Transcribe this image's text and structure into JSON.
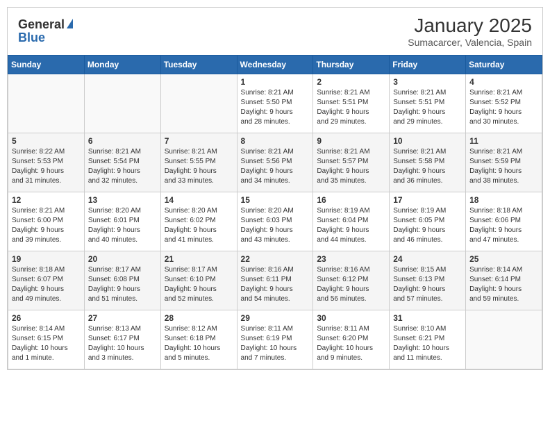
{
  "header": {
    "logo_general": "General",
    "logo_blue": "Blue",
    "month_year": "January 2025",
    "location": "Sumacarcer, Valencia, Spain"
  },
  "weekdays": [
    "Sunday",
    "Monday",
    "Tuesday",
    "Wednesday",
    "Thursday",
    "Friday",
    "Saturday"
  ],
  "weeks": [
    [
      {
        "day": "",
        "content": ""
      },
      {
        "day": "",
        "content": ""
      },
      {
        "day": "",
        "content": ""
      },
      {
        "day": "1",
        "content": "Sunrise: 8:21 AM\nSunset: 5:50 PM\nDaylight: 9 hours\nand 28 minutes."
      },
      {
        "day": "2",
        "content": "Sunrise: 8:21 AM\nSunset: 5:51 PM\nDaylight: 9 hours\nand 29 minutes."
      },
      {
        "day": "3",
        "content": "Sunrise: 8:21 AM\nSunset: 5:51 PM\nDaylight: 9 hours\nand 29 minutes."
      },
      {
        "day": "4",
        "content": "Sunrise: 8:21 AM\nSunset: 5:52 PM\nDaylight: 9 hours\nand 30 minutes."
      }
    ],
    [
      {
        "day": "5",
        "content": "Sunrise: 8:22 AM\nSunset: 5:53 PM\nDaylight: 9 hours\nand 31 minutes."
      },
      {
        "day": "6",
        "content": "Sunrise: 8:21 AM\nSunset: 5:54 PM\nDaylight: 9 hours\nand 32 minutes."
      },
      {
        "day": "7",
        "content": "Sunrise: 8:21 AM\nSunset: 5:55 PM\nDaylight: 9 hours\nand 33 minutes."
      },
      {
        "day": "8",
        "content": "Sunrise: 8:21 AM\nSunset: 5:56 PM\nDaylight: 9 hours\nand 34 minutes."
      },
      {
        "day": "9",
        "content": "Sunrise: 8:21 AM\nSunset: 5:57 PM\nDaylight: 9 hours\nand 35 minutes."
      },
      {
        "day": "10",
        "content": "Sunrise: 8:21 AM\nSunset: 5:58 PM\nDaylight: 9 hours\nand 36 minutes."
      },
      {
        "day": "11",
        "content": "Sunrise: 8:21 AM\nSunset: 5:59 PM\nDaylight: 9 hours\nand 38 minutes."
      }
    ],
    [
      {
        "day": "12",
        "content": "Sunrise: 8:21 AM\nSunset: 6:00 PM\nDaylight: 9 hours\nand 39 minutes."
      },
      {
        "day": "13",
        "content": "Sunrise: 8:20 AM\nSunset: 6:01 PM\nDaylight: 9 hours\nand 40 minutes."
      },
      {
        "day": "14",
        "content": "Sunrise: 8:20 AM\nSunset: 6:02 PM\nDaylight: 9 hours\nand 41 minutes."
      },
      {
        "day": "15",
        "content": "Sunrise: 8:20 AM\nSunset: 6:03 PM\nDaylight: 9 hours\nand 43 minutes."
      },
      {
        "day": "16",
        "content": "Sunrise: 8:19 AM\nSunset: 6:04 PM\nDaylight: 9 hours\nand 44 minutes."
      },
      {
        "day": "17",
        "content": "Sunrise: 8:19 AM\nSunset: 6:05 PM\nDaylight: 9 hours\nand 46 minutes."
      },
      {
        "day": "18",
        "content": "Sunrise: 8:18 AM\nSunset: 6:06 PM\nDaylight: 9 hours\nand 47 minutes."
      }
    ],
    [
      {
        "day": "19",
        "content": "Sunrise: 8:18 AM\nSunset: 6:07 PM\nDaylight: 9 hours\nand 49 minutes."
      },
      {
        "day": "20",
        "content": "Sunrise: 8:17 AM\nSunset: 6:08 PM\nDaylight: 9 hours\nand 51 minutes."
      },
      {
        "day": "21",
        "content": "Sunrise: 8:17 AM\nSunset: 6:10 PM\nDaylight: 9 hours\nand 52 minutes."
      },
      {
        "day": "22",
        "content": "Sunrise: 8:16 AM\nSunset: 6:11 PM\nDaylight: 9 hours\nand 54 minutes."
      },
      {
        "day": "23",
        "content": "Sunrise: 8:16 AM\nSunset: 6:12 PM\nDaylight: 9 hours\nand 56 minutes."
      },
      {
        "day": "24",
        "content": "Sunrise: 8:15 AM\nSunset: 6:13 PM\nDaylight: 9 hours\nand 57 minutes."
      },
      {
        "day": "25",
        "content": "Sunrise: 8:14 AM\nSunset: 6:14 PM\nDaylight: 9 hours\nand 59 minutes."
      }
    ],
    [
      {
        "day": "26",
        "content": "Sunrise: 8:14 AM\nSunset: 6:15 PM\nDaylight: 10 hours\nand 1 minute."
      },
      {
        "day": "27",
        "content": "Sunrise: 8:13 AM\nSunset: 6:17 PM\nDaylight: 10 hours\nand 3 minutes."
      },
      {
        "day": "28",
        "content": "Sunrise: 8:12 AM\nSunset: 6:18 PM\nDaylight: 10 hours\nand 5 minutes."
      },
      {
        "day": "29",
        "content": "Sunrise: 8:11 AM\nSunset: 6:19 PM\nDaylight: 10 hours\nand 7 minutes."
      },
      {
        "day": "30",
        "content": "Sunrise: 8:11 AM\nSunset: 6:20 PM\nDaylight: 10 hours\nand 9 minutes."
      },
      {
        "day": "31",
        "content": "Sunrise: 8:10 AM\nSunset: 6:21 PM\nDaylight: 10 hours\nand 11 minutes."
      },
      {
        "day": "",
        "content": ""
      }
    ]
  ]
}
